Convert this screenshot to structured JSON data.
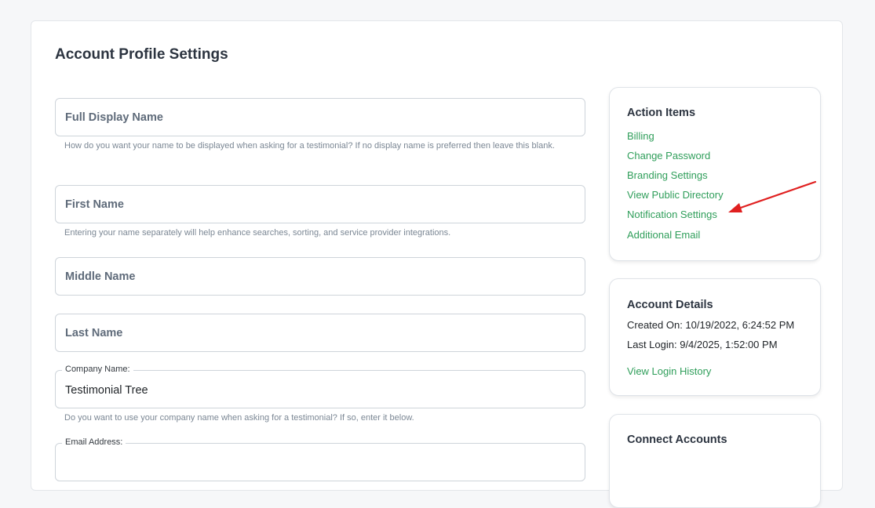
{
  "page": {
    "title": "Account Profile Settings"
  },
  "form": {
    "full_display_name": {
      "placeholder": "Full Display Name",
      "help": "How do you want your name to be displayed when asking for a testimonial? If no display name is preferred then leave this blank."
    },
    "first_name": {
      "placeholder": "First Name",
      "help": "Entering your name separately will help enhance searches, sorting, and service provider integrations."
    },
    "middle_name": {
      "placeholder": "Middle Name"
    },
    "last_name": {
      "placeholder": "Last Name"
    },
    "company_name": {
      "label": "Company Name:",
      "value": "Testimonial Tree",
      "help": "Do you want to use your company name when asking for a testimonial? If so, enter it below."
    },
    "email_address": {
      "label": "Email Address:"
    }
  },
  "action_items": {
    "title": "Action Items",
    "links": [
      "Billing",
      "Change Password",
      "Branding Settings",
      "View Public Directory",
      "Notification Settings",
      "Additional Email"
    ]
  },
  "account_details": {
    "title": "Account Details",
    "created_on": "Created On: 10/19/2022, 6:24:52 PM",
    "last_login": "Last Login: 9/4/2025, 1:52:00 PM",
    "login_history_link": "View Login History"
  },
  "connect_accounts": {
    "title": "Connect Accounts"
  },
  "colors": {
    "link_green": "#2f9e5a",
    "annotation_arrow": "#e02020"
  }
}
